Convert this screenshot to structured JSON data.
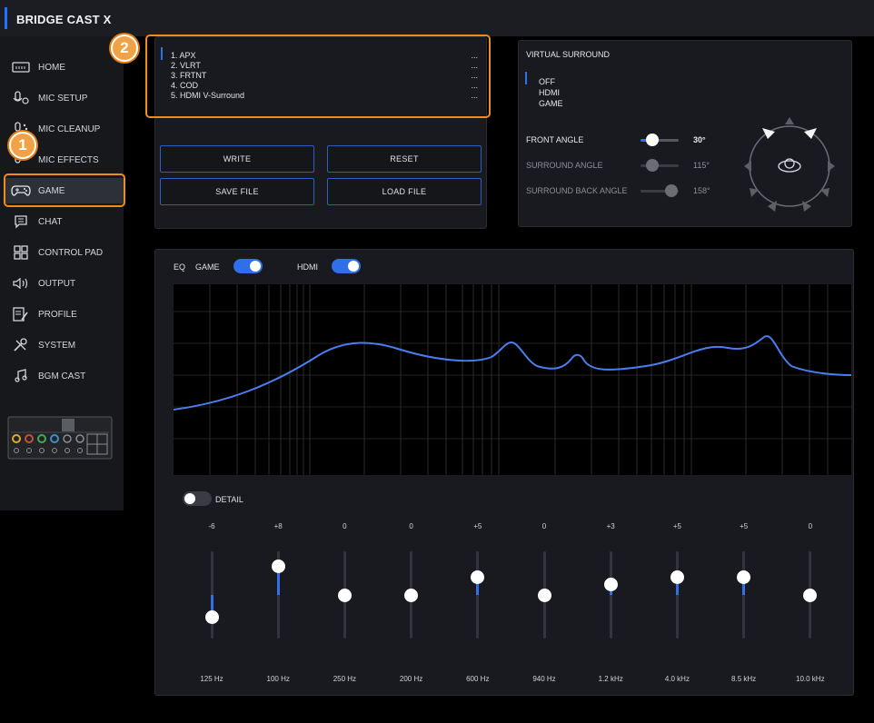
{
  "app": {
    "title": "BRIDGE CAST X"
  },
  "sidebar": {
    "items": [
      {
        "label": "HOME",
        "icon": "keyboard-icon"
      },
      {
        "label": "MIC SETUP",
        "icon": "microphone-icon"
      },
      {
        "label": "MIC CLEANUP",
        "icon": "microphone-clean-icon"
      },
      {
        "label": "MIC EFFECTS",
        "icon": "microphone-effects-icon"
      },
      {
        "label": "GAME",
        "icon": "gamepad-icon",
        "active": true
      },
      {
        "label": "CHAT",
        "icon": "chat-icon"
      },
      {
        "label": "CONTROL PAD",
        "icon": "grid-icon"
      },
      {
        "label": "OUTPUT",
        "icon": "speaker-icon"
      },
      {
        "label": "PROFILE",
        "icon": "profile-edit-icon"
      },
      {
        "label": "SYSTEM",
        "icon": "tools-icon"
      },
      {
        "label": "BGM CAST",
        "icon": "music-note-icon"
      }
    ]
  },
  "callouts": {
    "one": "1",
    "two": "2"
  },
  "presets": {
    "items": [
      {
        "name": "1. APX",
        "value": "..."
      },
      {
        "name": "2. VLRT",
        "value": "..."
      },
      {
        "name": "3. FRTNT",
        "value": "..."
      },
      {
        "name": "4. COD",
        "value": "..."
      },
      {
        "name": "5. HDMI V-Surround",
        "value": "..."
      }
    ]
  },
  "buttons": {
    "write": "WRITE",
    "reset": "RESET",
    "save_file": "SAVE FILE",
    "load_file": "LOAD FILE"
  },
  "virtual_surround": {
    "title": "VIRTUAL SURROUND",
    "options": [
      "OFF",
      "HDMI",
      "GAME"
    ],
    "selected": "OFF",
    "front_angle": {
      "label": "FRONT ANGLE",
      "value": "30°",
      "level": 0.3
    },
    "surround_angle": {
      "label": "SURROUND ANGLE",
      "value": "115°",
      "level": 0.3
    },
    "surround_back_angle": {
      "label": "SURROUND BACK ANGLE",
      "value": "158°",
      "level": 0.8
    }
  },
  "eq": {
    "label": "EQ",
    "game_label": "GAME",
    "game_on": true,
    "hdmi_label": "HDMI",
    "hdmi_on": true,
    "detail_label": "DETAIL",
    "detail_on": false,
    "bands": [
      {
        "freq": "125 Hz",
        "gain": "-6",
        "level": -6
      },
      {
        "freq": "100 Hz",
        "gain": "+8",
        "level": 8
      },
      {
        "freq": "250 Hz",
        "gain": "0",
        "level": 0
      },
      {
        "freq": "200 Hz",
        "gain": "0",
        "level": 0
      },
      {
        "freq": "600 Hz",
        "gain": "+5",
        "level": 5
      },
      {
        "freq": "940 Hz",
        "gain": "0",
        "level": 0
      },
      {
        "freq": "1.2 kHz",
        "gain": "+3",
        "level": 3
      },
      {
        "freq": "4.0 kHz",
        "gain": "+5",
        "level": 5
      },
      {
        "freq": "8.5 kHz",
        "gain": "+5",
        "level": 5
      },
      {
        "freq": "10.0 kHz",
        "gain": "0",
        "level": 0
      }
    ]
  },
  "colors": {
    "accent": "#2f6fe8",
    "callout": "#f08c1e"
  }
}
